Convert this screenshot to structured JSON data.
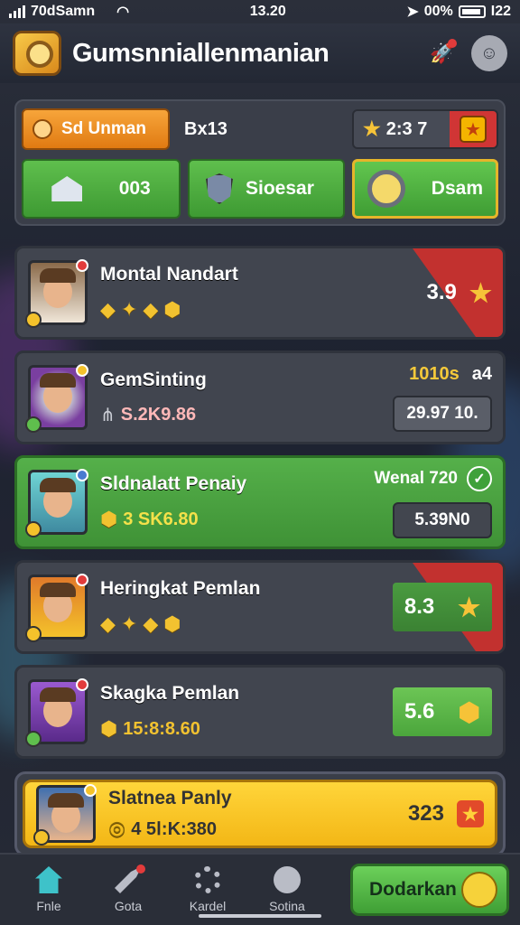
{
  "status_bar": {
    "carrier": "70dSamn",
    "time": "13.20",
    "battery_text": "00%",
    "extra": "I22"
  },
  "header": {
    "title": "Gumsnniallenmanian",
    "icons": [
      "app-logo-icon",
      "rocket-icon",
      "smile-icon"
    ]
  },
  "panel": {
    "user_label": "Sd Unman",
    "rank_text": "Bx13",
    "score_text": "2:3 7",
    "tabs": {
      "home_value": "003",
      "store_label": "Sioesar",
      "search_label": "Dsam"
    }
  },
  "rows": [
    {
      "name": "Montal Nandart",
      "score": "3.9",
      "style": "ribbon"
    },
    {
      "name": "GemSinting",
      "gold_label": "1010s",
      "gold_suffix": "a4",
      "amount": "S.2K9.86",
      "value_box": "29.97 10."
    },
    {
      "name": "Sldnalatt Penaiy",
      "status_label": "Wenal 720",
      "amount": "3 SK6.80",
      "value_box": "5.39N0"
    },
    {
      "name": "Heringkat Pemlan",
      "score": "8.3"
    },
    {
      "name": "Skagka Pemlan",
      "amount": "15:8:8.60",
      "score": "5.6"
    },
    {
      "name": "Slatnea Panly",
      "amount": "4 5Ⅰ:K:380",
      "score": "323"
    }
  ],
  "bottom_nav": {
    "items": [
      {
        "label": "Fnle",
        "icon": "home-icon"
      },
      {
        "label": "Gota",
        "icon": "rocket-icon"
      },
      {
        "label": "Kardel",
        "icon": "gear-icon"
      },
      {
        "label": "Sotina",
        "icon": "face-icon"
      }
    ],
    "cta_label": "Dodarkan"
  },
  "colors": {
    "accent_green": "#4ba63c",
    "accent_orange": "#e07a12",
    "accent_red": "#c2312f",
    "accent_gold": "#f6c338"
  }
}
